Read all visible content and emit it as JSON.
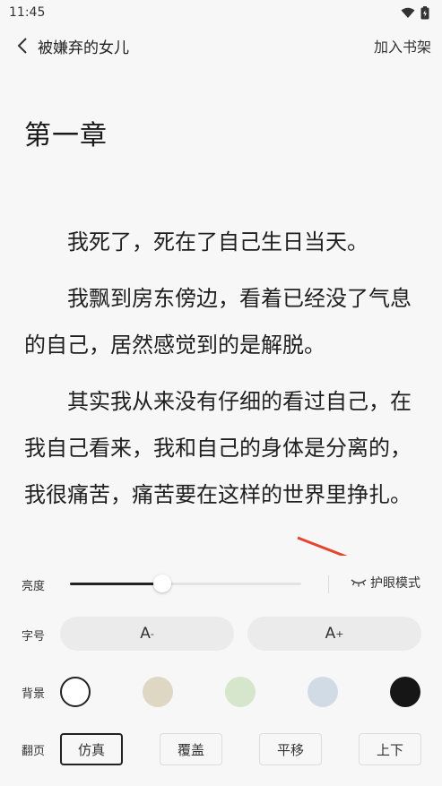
{
  "status": {
    "time": "11:45"
  },
  "header": {
    "title": "被嫌弃的女儿",
    "add_shelf": "加入书架"
  },
  "chapter": {
    "title": "第一章",
    "paragraphs": [
      "我死了，死在了自己生日当天。",
      "我飘到房东傍边，看着已经没了气息的自己，居然感觉到的是解脱。",
      "其实我从来没有仔细的看过自己，在我自己看来，我和自己的身体是分离的，我很痛苦，痛苦要在这样的世界里挣扎。"
    ]
  },
  "settings": {
    "brightness": {
      "label": "亮度",
      "level": 0.4,
      "eye_mode": "护眼模式"
    },
    "font_size": {
      "label": "字号",
      "decrease": "A",
      "decrease_sup": "-",
      "increase": "A",
      "increase_sup": "+"
    },
    "background": {
      "label": "背景",
      "swatches": [
        "#ffffff",
        "#ddd7c4",
        "#d6e6cc",
        "#d1dbe6",
        "#161616"
      ],
      "selected": 0
    },
    "page_flip": {
      "label": "翻页",
      "options": [
        "仿真",
        "覆盖",
        "平移",
        "上下"
      ],
      "selected": 0
    }
  },
  "colors": {
    "accent_arrow": "#e5452f",
    "text": "#1f1f1f"
  }
}
